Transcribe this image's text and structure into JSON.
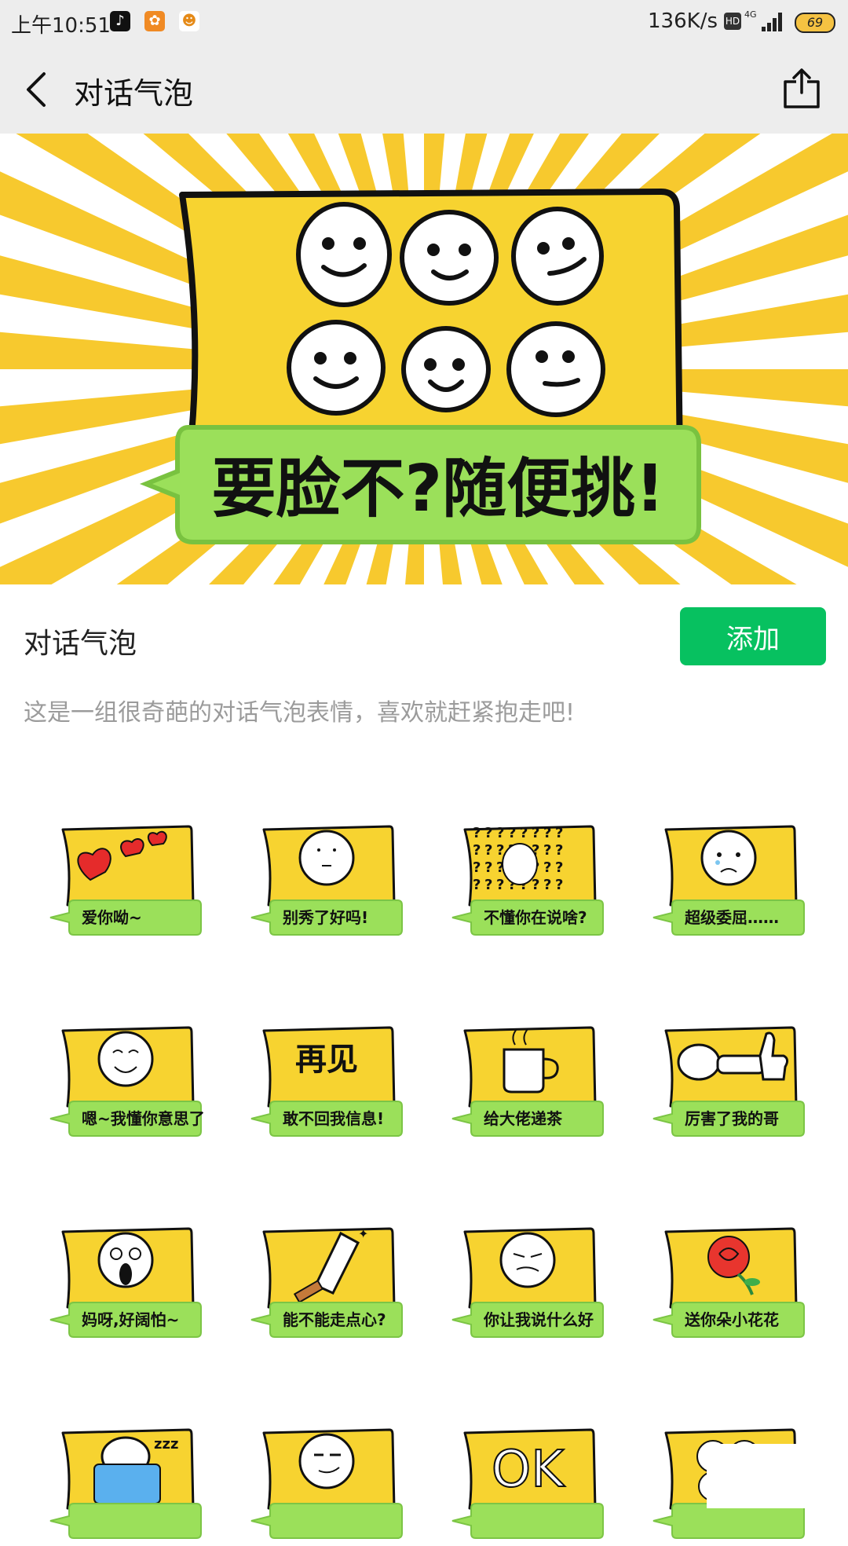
{
  "status_bar": {
    "time": "上午10:51",
    "network_speed": "136K/s",
    "hd_label": "HD",
    "signal_label": "4G",
    "battery": "69"
  },
  "app_bar": {
    "title": "对话气泡",
    "back_icon": "chevron-left-icon",
    "share_icon": "share-icon"
  },
  "banner": {
    "headline": "要脸不?随便挑!"
  },
  "pack": {
    "name": "对话气泡",
    "add_label": "添加",
    "description": "这是一组很奇葩的对话气泡表情，喜欢就赶紧抱走吧!"
  },
  "stickers": [
    {
      "caption": "爱你呦~",
      "art": "hearts"
    },
    {
      "caption": "别秀了好吗!",
      "art": "face-flat"
    },
    {
      "caption": "不懂你在说啥?",
      "art": "question-marks"
    },
    {
      "caption": "超级委屈……",
      "art": "face-sad"
    },
    {
      "caption": "嗯~我懂你意思了",
      "art": "face-smile"
    },
    {
      "caption": "敢不回我信息!",
      "art": "text-zaijian",
      "art_text": "再见"
    },
    {
      "caption": "给大佬递茶",
      "art": "tea-cup"
    },
    {
      "caption": "厉害了我的哥",
      "art": "thumbs-up"
    },
    {
      "caption": "妈呀,好阔怕~",
      "art": "face-scared"
    },
    {
      "caption": "能不能走点心?",
      "art": "cleaver"
    },
    {
      "caption": "你让我说什么好",
      "art": "face-meh"
    },
    {
      "caption": "送你朵小花花",
      "art": "rose"
    },
    {
      "caption": "",
      "art": "sleeping"
    },
    {
      "caption": "",
      "art": "face-smirk"
    },
    {
      "caption": "",
      "art": "ok-text",
      "art_text": "OK"
    },
    {
      "caption": "",
      "art": "faces-many"
    }
  ],
  "colors": {
    "accent_green": "#07c160",
    "bubble_yellow": "#f7d330",
    "bubble_green": "#9be05a",
    "app_bar_bg": "#ededed"
  }
}
